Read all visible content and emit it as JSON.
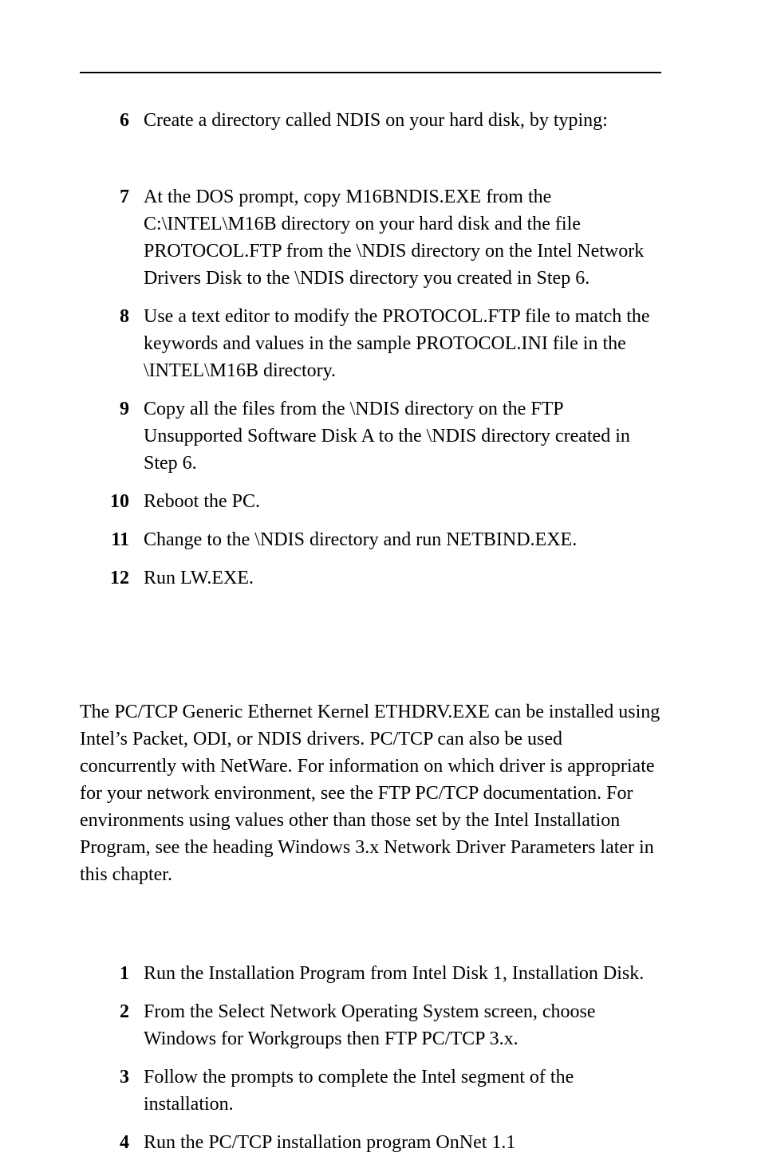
{
  "steps_a": [
    {
      "n": "6",
      "t": "Create a directory called NDIS on your hard disk, by typing:"
    },
    {
      "n": "7",
      "t": "At the DOS prompt, copy M16BNDIS.EXE from the C:\\INTEL\\M16B directory on your hard disk and the file PROTOCOL.FTP from the \\NDIS directory on the Intel Network Drivers Disk to the \\NDIS directory you created in Step 6."
    },
    {
      "n": "8",
      "t": "Use a text editor to modify the PROTOCOL.FTP file to match the keywords and values in the sample PROTOCOL.INI file in the \\INTEL\\M16B directory."
    },
    {
      "n": "9",
      "t": "Copy all the files from the \\NDIS directory on the FTP Unsupported Software Disk A to the \\NDIS directory created in Step 6."
    },
    {
      "n": "10",
      "t": "Reboot the PC."
    },
    {
      "n": "11",
      "t": "Change to the \\NDIS directory and run NETBIND.EXE."
    },
    {
      "n": "12",
      "t": "Run LW.EXE."
    }
  ],
  "body": "The PC/TCP Generic Ethernet Kernel ETHDRV.EXE can be installed using Intel’s Packet, ODI, or NDIS drivers. PC/TCP can also be used concurrently with NetWare. For information on which driver is appropriate for your network environment, see the FTP PC/TCP documentation. For environments using values other than those set by the Intel Installation Program, see the heading Windows 3.x Network Driver Parameters later in this chapter.",
  "steps_b": [
    {
      "n": "1",
      "t": "Run the Installation Program from Intel Disk 1, Installation Disk."
    },
    {
      "n": "2",
      "t": "From the Select Network Operating System screen, choose Windows for Workgroups then FTP PC/TCP 3.x."
    },
    {
      "n": "3",
      "t": "Follow the prompts to complete the Intel segment of the installation."
    },
    {
      "n": "4",
      "t": "Run the PC/TCP installation program OnNet 1.1"
    }
  ]
}
